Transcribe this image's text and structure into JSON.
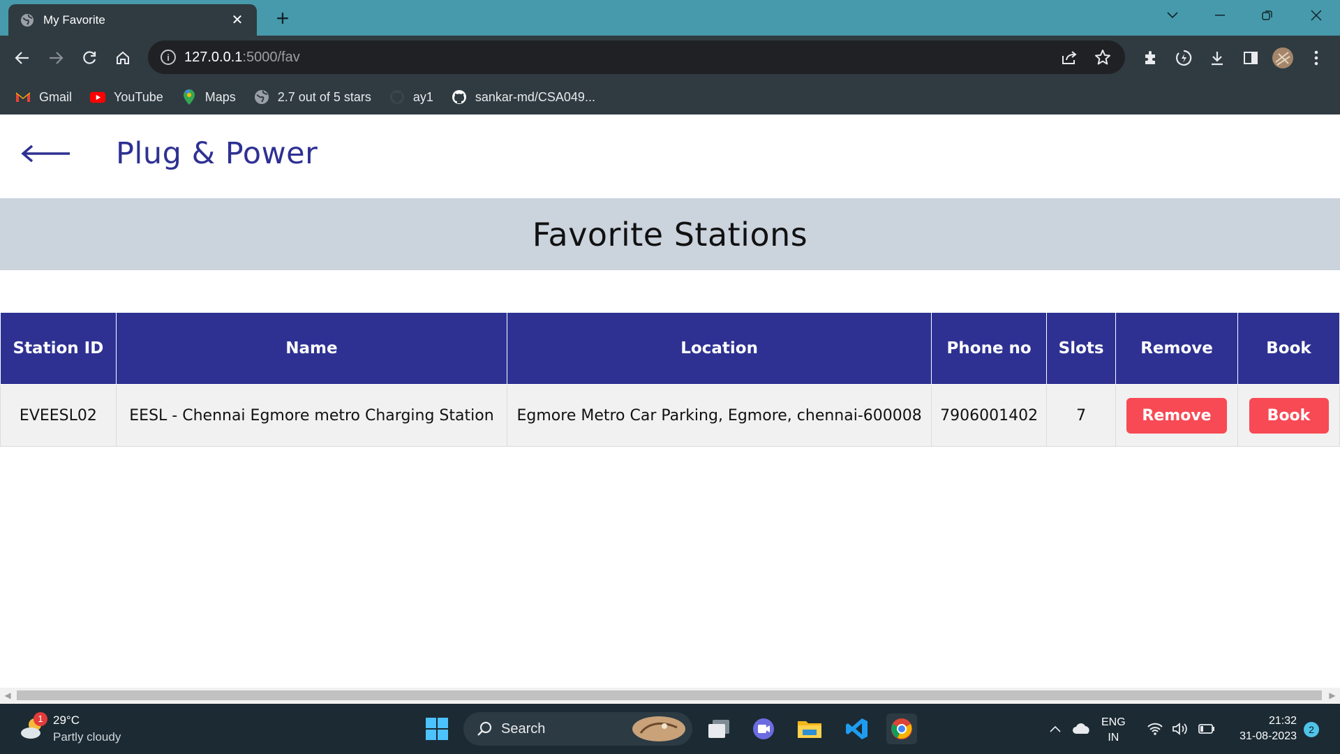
{
  "browser": {
    "tab_title": "My Favorite",
    "tab_close": "✕",
    "new_tab": "+",
    "url_host": "127.0.0.1",
    "url_path": ":5000/fav",
    "bookmarks": [
      {
        "label": "Gmail",
        "icon": "gmail-icon"
      },
      {
        "label": "YouTube",
        "icon": "youtube-icon"
      },
      {
        "label": "Maps",
        "icon": "maps-icon"
      },
      {
        "label": "2.7 out of 5 stars",
        "icon": "globe-icon"
      },
      {
        "label": "ay1",
        "icon": "github-icon"
      },
      {
        "label": "sankar-md/CSA049...",
        "icon": "github-icon"
      }
    ]
  },
  "page": {
    "brand": "Plug & Power",
    "heading": "Favorite Stations",
    "table": {
      "headers": [
        "Station ID",
        "Name",
        "Location",
        "Phone no",
        "Slots",
        "Remove",
        "Book"
      ],
      "rows": [
        {
          "station_id": "EVEESL02",
          "name": "EESL - Chennai Egmore metro Charging Station",
          "location": "Egmore Metro Car Parking, Egmore, chennai-600008",
          "phone": "7906001402",
          "slots": "7",
          "remove_label": "Remove",
          "book_label": "Book"
        }
      ]
    }
  },
  "taskbar": {
    "weather_badge": "1",
    "temperature": "29°C",
    "condition": "Partly cloudy",
    "search_label": "Search",
    "lang_top": "ENG",
    "lang_bottom": "IN",
    "time": "21:32",
    "date": "31-08-2023",
    "notification_count": "2"
  },
  "colors": {
    "brand": "#2e3192",
    "button": "#f74a55",
    "banner": "#cbd3dd",
    "tabbar": "#479aab"
  }
}
